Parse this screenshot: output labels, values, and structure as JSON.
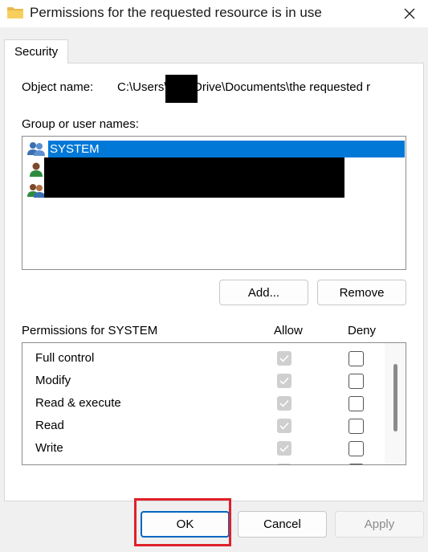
{
  "window": {
    "title": "Permissions for the requested resource is in use",
    "close_icon": "close-icon",
    "folder_icon": "folder-icon"
  },
  "tabs": [
    {
      "label": "Security",
      "active": true
    }
  ],
  "object": {
    "label": "Object name:",
    "value": "C:\\Users\\        OneDrive\\Documents\\the requested r"
  },
  "groups": {
    "label": "Group or user names:",
    "users": [
      {
        "name": "SYSTEM",
        "icon": "user-group-icon",
        "selected": true
      },
      {
        "name": "",
        "icon": "user-icon",
        "selected": false
      },
      {
        "name": "",
        "icon": "user-group-icon",
        "selected": false
      }
    ]
  },
  "buttons": {
    "add": "Add...",
    "remove": "Remove",
    "ok": "OK",
    "cancel": "Cancel",
    "apply": "Apply"
  },
  "permissions": {
    "label": "Permissions for SYSTEM",
    "allow_header": "Allow",
    "deny_header": "Deny",
    "rows": [
      {
        "name": "Full control",
        "allow": true,
        "deny": false
      },
      {
        "name": "Modify",
        "allow": true,
        "deny": false
      },
      {
        "name": "Read & execute",
        "allow": true,
        "deny": false
      },
      {
        "name": "Read",
        "allow": true,
        "deny": false
      },
      {
        "name": "Write",
        "allow": true,
        "deny": false
      }
    ]
  },
  "colors": {
    "selection": "#0078d7",
    "highlight": "#e0202a",
    "default_button_border": "#0067c0"
  }
}
